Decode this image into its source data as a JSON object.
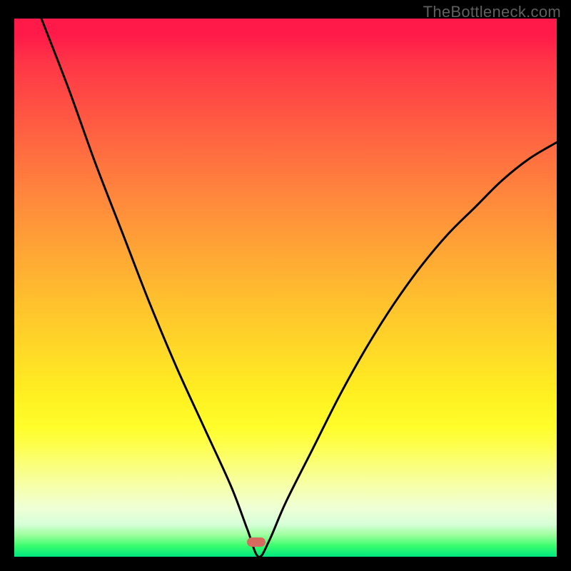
{
  "watermark": "TheBottleneck.com",
  "colors": {
    "curve": "#000000",
    "marker": "#d66a5f",
    "frame": "#000000"
  },
  "marker": {
    "x_pct": 44.6,
    "y_pct": 97.2
  },
  "chart_data": {
    "type": "line",
    "title": "",
    "xlabel": "",
    "ylabel": "",
    "xlim": [
      0,
      100
    ],
    "ylim": [
      0,
      100
    ],
    "series": [
      {
        "name": "bottleneck-curve",
        "x": [
          5,
          10,
          15,
          20,
          25,
          30,
          35,
          40,
          43,
          45,
          47,
          50,
          55,
          60,
          65,
          70,
          75,
          80,
          85,
          90,
          95,
          100
        ],
        "values": [
          100,
          87,
          73,
          60,
          47,
          35,
          24,
          13,
          5,
          0,
          3,
          10,
          20,
          30,
          39,
          47,
          54,
          60,
          65,
          70,
          74,
          77
        ]
      }
    ],
    "annotations": [
      {
        "name": "optimal-marker",
        "x": 45,
        "y": 2
      }
    ],
    "gradient_stops": [
      {
        "pct": 0,
        "color": "#ff1a49"
      },
      {
        "pct": 50,
        "color": "#ffbf2e"
      },
      {
        "pct": 75,
        "color": "#fff021"
      },
      {
        "pct": 100,
        "color": "#00e780"
      }
    ]
  }
}
